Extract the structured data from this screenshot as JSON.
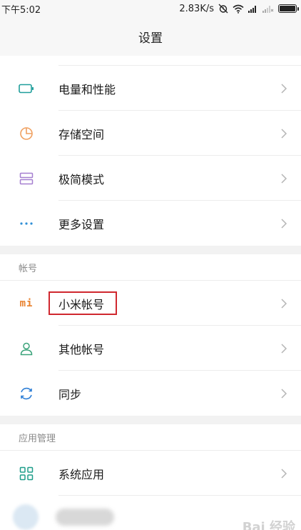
{
  "status_bar": {
    "time": "下午5:02",
    "speed": "2.83K/s"
  },
  "title": "设置",
  "groups": {
    "general": [
      {
        "label": "电量和性能",
        "icon": "battery-icon"
      },
      {
        "label": "存储空间",
        "icon": "storage-pie-icon"
      },
      {
        "label": "极简模式",
        "icon": "simple-mode-icon"
      },
      {
        "label": "更多设置",
        "icon": "more-dots-icon"
      }
    ],
    "accounts": {
      "header": "帐号",
      "items": [
        {
          "label": "小米帐号",
          "icon": "mi-logo-icon"
        },
        {
          "label": "其他帐号",
          "icon": "person-icon"
        },
        {
          "label": "同步",
          "icon": "sync-icon"
        }
      ]
    },
    "apps": {
      "header": "应用管理",
      "items": [
        {
          "label": "系统应用",
          "icon": "grid-icon"
        }
      ]
    }
  },
  "mi_logo_text": "mi",
  "watermark": "Bai 经验",
  "colors": {
    "accent_teal": "#2aa198",
    "battery_teal": "#1f9e9b",
    "storage_orange": "#f0a060",
    "simple_purple": "#a57fd0",
    "more_blue": "#2f8fd6",
    "mi_orange": "#e8812d",
    "person_green": "#3aa37a",
    "sync_blue": "#2f7fd6",
    "grid_teal": "#1f9e8a",
    "highlight_red": "#d0282f"
  }
}
